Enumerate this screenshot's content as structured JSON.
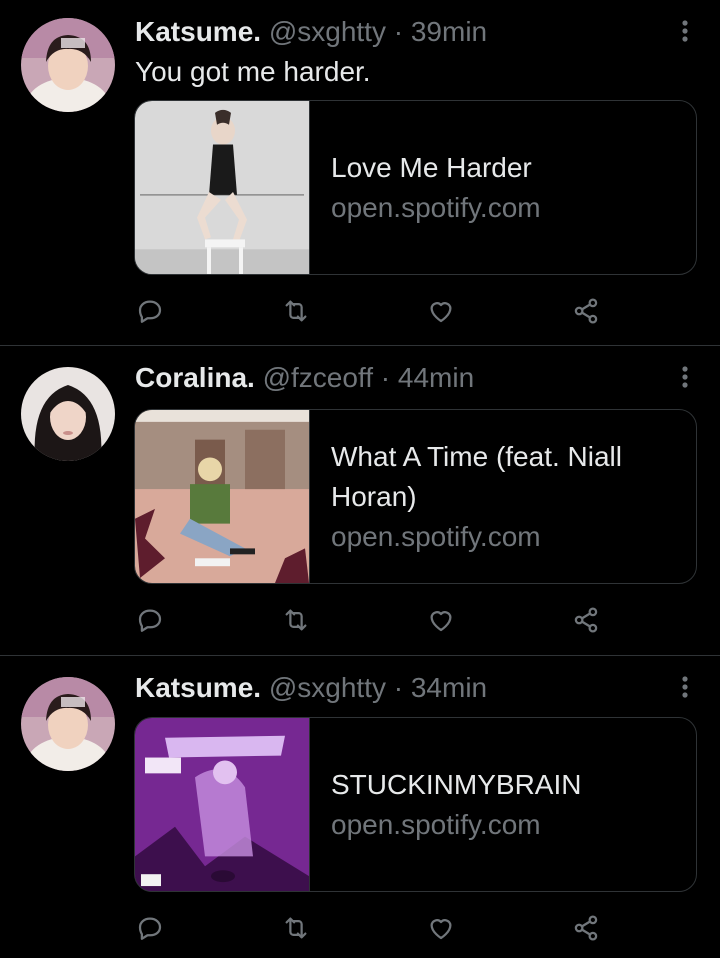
{
  "tweets": [
    {
      "name": "Katsume.",
      "handle": "@sxghtty",
      "separator": "·",
      "time": "39min",
      "text": "You got me harder.",
      "card": {
        "title": "Love Me Harder",
        "domain": "open.spotify.com"
      }
    },
    {
      "name": "Coralina.",
      "handle": "@fzceoff",
      "separator": "·",
      "time": "44min",
      "text": "",
      "card": {
        "title": "What A Time (feat. Niall Horan)",
        "domain": "open.spotify.com"
      }
    },
    {
      "name": "Katsume.",
      "handle": "@sxghtty",
      "separator": "·",
      "time": "34min",
      "text": "",
      "card": {
        "title": "STUCKINMYBRAIN",
        "domain": "open.spotify.com"
      }
    }
  ],
  "icons": {
    "reply": "reply-icon",
    "retweet": "retweet-icon",
    "like": "heart-icon",
    "share": "share-icon",
    "more": "more-vertical-icon"
  },
  "colors": {
    "background": "#000000",
    "text": "#e7e9ea",
    "muted": "#71767b",
    "border": "#2f3336"
  }
}
